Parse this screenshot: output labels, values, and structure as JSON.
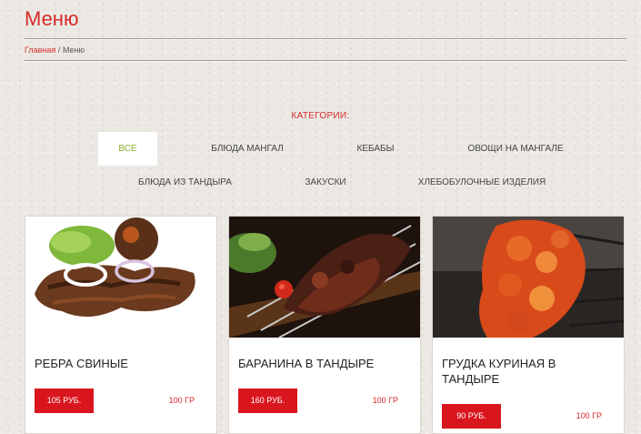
{
  "page": {
    "title": "Меню"
  },
  "breadcrumb": {
    "home": "Главная",
    "separator": "/",
    "current": "Меню"
  },
  "categories": {
    "title": "КАТЕГОРИИ:",
    "filters": [
      "ВСЕ",
      "БЛЮДА МАНГАЛ",
      "КЕБАБЫ",
      "ОВОЩИ НА МАНГАЛЕ",
      "БЛЮДА ИЗ ТАНДЫРА",
      "ЗАКУСКИ",
      "ХЛЕБОБУЛОЧНЫЕ ИЗДЕЛИЯ"
    ],
    "active_filter": "ВСЕ"
  },
  "products": [
    {
      "name": "РЕБРА СВИНЫЕ",
      "price": "105 РУБ.",
      "weight": "100 ГР"
    },
    {
      "name": "БАРАНИНА В ТАНДЫРЕ",
      "price": "160 РУБ.",
      "weight": "100 ГР"
    },
    {
      "name": "ГРУДКА КУРИНАЯ В ТАНДЫРЕ",
      "price": "90 РУБ.",
      "weight": "100 ГР"
    }
  ],
  "colors": {
    "accent": "#d62b2b",
    "price_bg": "#d9161e",
    "active_filter": "#8fae2c"
  }
}
